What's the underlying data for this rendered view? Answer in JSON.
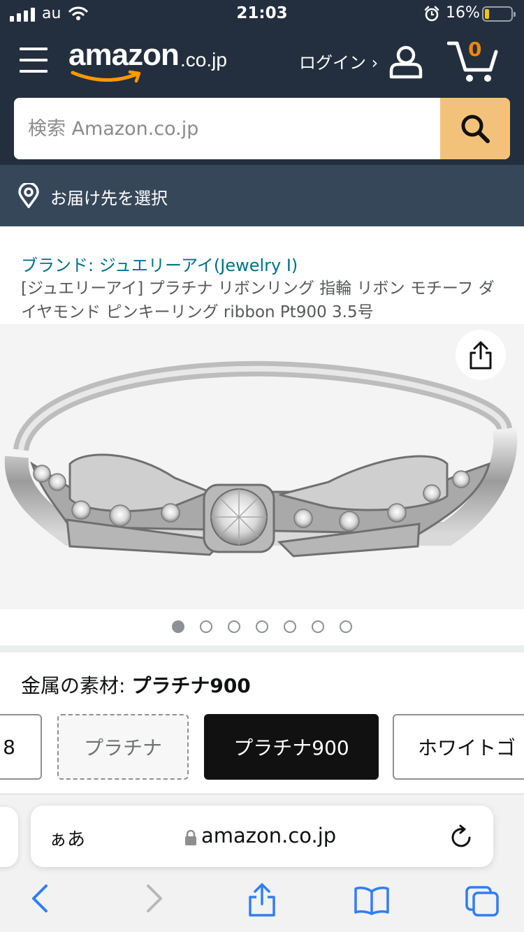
{
  "status_bar": {
    "carrier": "au",
    "time": "21:03",
    "battery_percent": "16%",
    "icons": [
      "signal-icon",
      "wifi-icon",
      "alarm-icon",
      "battery-icon"
    ]
  },
  "header": {
    "logo_word": "amazon",
    "logo_tld": ".co.jp",
    "login_label": "ログイン ›",
    "cart_count": "0",
    "search_placeholder": "検索 Amazon.co.jp",
    "deliver_label": "お届け先を選択"
  },
  "product": {
    "brand_link": "ブランド: ジュエリーアイ(Jewelry I)",
    "title": "[ジュエリーアイ] プラチナ リボンリング 指輪 リボン モチーフ ダイヤモンド ピンキーリング ribbon Pt900 3.5号",
    "image_count": 7,
    "current_image": 1
  },
  "variation": {
    "label": "金属の素材: ",
    "selected_value": "プラチナ900",
    "options": [
      {
        "label": "8",
        "state": "normal"
      },
      {
        "label": "プラチナ",
        "state": "unavailable"
      },
      {
        "label": "プラチナ900",
        "state": "selected"
      },
      {
        "label": "ホワイトゴ",
        "state": "normal"
      }
    ]
  },
  "safari": {
    "text_size_label": "ぁあ",
    "url": "amazon.co.jp",
    "toolbar": [
      "back-icon",
      "forward-icon",
      "share-icon",
      "bookmarks-icon",
      "tabs-icon"
    ]
  },
  "colors": {
    "header_bg": "#232f3e",
    "deliver_bg": "#37475a",
    "search_button": "#f3c27a",
    "link": "#007185",
    "cart_count": "#f08804",
    "safari_blue": "#2f7ef5"
  }
}
